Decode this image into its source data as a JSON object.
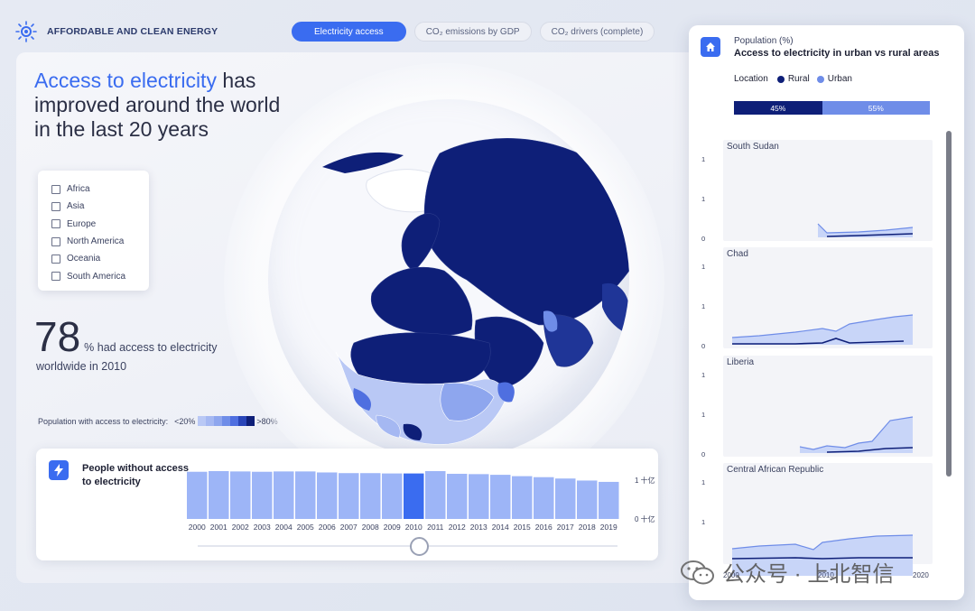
{
  "header": {
    "brand": "AFFORDABLE AND CLEAN ENERGY",
    "tabs": [
      {
        "label": "Electricity access",
        "active": true
      },
      {
        "label": "CO₂ emissions by GDP",
        "active": false
      },
      {
        "label": "CO₂ drivers (complete)",
        "active": false
      }
    ]
  },
  "main": {
    "headline_accent": "Access to electricity",
    "headline_rest": " has improved around the world in the last 20 years",
    "regions": [
      "Africa",
      "Asia",
      "Europe",
      "North America",
      "Oceania",
      "South America"
    ],
    "stat_value": "78",
    "stat_text": "% had access to electricity",
    "stat_sub_prefix": "worldwide in ",
    "stat_year": "2010",
    "legend_label": "Population with access to electricity:",
    "legend_low": "<20%",
    "legend_high": ">80%",
    "legend_colors": [
      "#b9c8f5",
      "#a5b8f2",
      "#8ea6ee",
      "#6f8de8",
      "#4f6fe0",
      "#2945b8",
      "#0e1f78"
    ]
  },
  "people": {
    "title": "People without access to electricity",
    "y_top": "1 十亿",
    "y_bottom": "0 十亿",
    "selected_year": "2010"
  },
  "chart_data": {
    "type": "bar",
    "title": "People without access to electricity",
    "categories": [
      "2000",
      "2001",
      "2002",
      "2003",
      "2004",
      "2005",
      "2006",
      "2007",
      "2008",
      "2009",
      "2010",
      "2011",
      "2012",
      "2013",
      "2014",
      "2015",
      "2016",
      "2017",
      "2018",
      "2019"
    ],
    "values": [
      1.4,
      1.42,
      1.41,
      1.4,
      1.41,
      1.41,
      1.38,
      1.36,
      1.36,
      1.35,
      1.35,
      1.42,
      1.34,
      1.33,
      1.31,
      1.27,
      1.24,
      1.2,
      1.14,
      1.1
    ],
    "ylim": [
      0,
      1.5
    ],
    "colors": {
      "bar": "#9db5f7",
      "selected": "#3a6cf0"
    }
  },
  "right_panel": {
    "subtitle": "Population (%)",
    "title": "Access to electricity in urban vs rural areas",
    "location_label": "Location",
    "rural_label": "Rural",
    "urban_label": "Urban",
    "rural_pct": "45%",
    "urban_pct": "55%",
    "rural_color": "#0e1f78",
    "urban_color": "#6f8de8",
    "countries": [
      {
        "name": "South Sudan",
        "y_labels": [
          "1",
          "1",
          "0"
        ]
      },
      {
        "name": "Chad",
        "y_labels": [
          "1",
          "1",
          "0"
        ]
      },
      {
        "name": "Liberia",
        "y_labels": [
          "1",
          "1",
          "0"
        ]
      },
      {
        "name": "Central African Republic",
        "y_labels": [
          "1",
          "1"
        ]
      }
    ],
    "x_labels": [
      "2000",
      "2010",
      "2020"
    ]
  },
  "watermark": "公众号 · 上北智信"
}
